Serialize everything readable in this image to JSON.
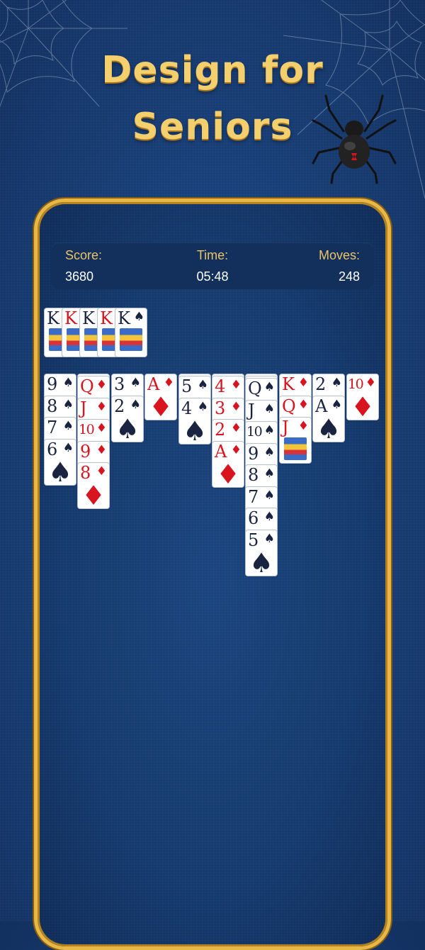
{
  "headline": {
    "line1": "Design for",
    "line2": "Seniors"
  },
  "scoreboard": {
    "score_label": "Score:",
    "score_value": "3680",
    "time_label": "Time:",
    "time_value": "05:48",
    "moves_label": "Moves:",
    "moves_value": "248"
  },
  "colors": {
    "gold": "#f3cf6e",
    "felt": "#1b457f",
    "red_suit": "#d8141f",
    "black_suit": "#1a2440"
  },
  "completed_stacks": [
    {
      "rank": "K",
      "suit": "♠",
      "color": "blk"
    },
    {
      "rank": "K",
      "suit": "♦",
      "color": "red"
    },
    {
      "rank": "K",
      "suit": "♠",
      "color": "blk"
    },
    {
      "rank": "K",
      "suit": "♦",
      "color": "red"
    },
    {
      "rank": "K",
      "suit": "♠",
      "color": "blk"
    }
  ],
  "tableau": [
    {
      "backs": 0,
      "cards": [
        [
          "9",
          "♠"
        ],
        [
          "8",
          "♠"
        ],
        [
          "7",
          "♠"
        ],
        [
          "6",
          "♠"
        ]
      ]
    },
    {
      "backs": 1,
      "cards": [
        [
          "Q",
          "♦"
        ],
        [
          "J",
          "♦"
        ],
        [
          "10",
          "♦"
        ],
        [
          "9",
          "♦"
        ],
        [
          "8",
          "♦"
        ]
      ]
    },
    {
      "backs": 0,
      "cards": [
        [
          "3",
          "♠"
        ],
        [
          "2",
          "♠"
        ]
      ]
    },
    {
      "backs": 0,
      "cards": [
        [
          "A",
          "♦"
        ]
      ]
    },
    {
      "backs": 1,
      "cards": [
        [
          "5",
          "♠"
        ],
        [
          "4",
          "♠"
        ]
      ]
    },
    {
      "backs": 1,
      "cards": [
        [
          "4",
          "♦"
        ],
        [
          "3",
          "♦"
        ],
        [
          "2",
          "♦"
        ],
        [
          "A",
          "♦"
        ]
      ]
    },
    {
      "backs": 2,
      "cards": [
        [
          "Q",
          "♠"
        ],
        [
          "J",
          "♠"
        ],
        [
          "10",
          "♠"
        ],
        [
          "9",
          "♠"
        ],
        [
          "8",
          "♠"
        ],
        [
          "7",
          "♠"
        ],
        [
          "6",
          "♠"
        ],
        [
          "5",
          "♠"
        ]
      ]
    },
    {
      "backs": 0,
      "cards": [
        [
          "K",
          "♦"
        ],
        [
          "Q",
          "♦"
        ],
        [
          "J",
          "♦"
        ]
      ]
    },
    {
      "backs": 0,
      "cards": [
        [
          "2",
          "♠"
        ],
        [
          "A",
          "♠"
        ]
      ]
    },
    {
      "backs": 0,
      "cards": [
        [
          "10",
          "♦"
        ]
      ]
    }
  ]
}
